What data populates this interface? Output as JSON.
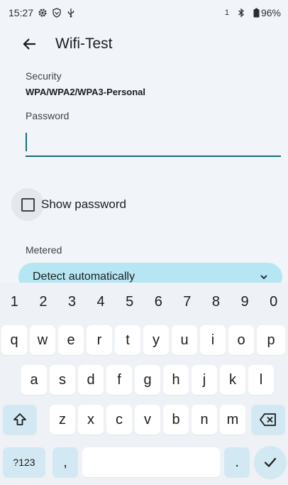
{
  "status_bar": {
    "time": "15:27",
    "sim_slot": "1",
    "battery": "96%"
  },
  "app_bar": {
    "title": "Wifi-Test"
  },
  "form": {
    "security_label": "Security",
    "security_value": "WPA/WPA2/WPA3-Personal",
    "password_label": "Password",
    "password_value": "",
    "show_password_label": "Show password",
    "show_password_checked": false,
    "metered_label": "Metered",
    "metered_value": "Detect automatically"
  },
  "keyboard": {
    "number_row": [
      "1",
      "2",
      "3",
      "4",
      "5",
      "6",
      "7",
      "8",
      "9",
      "0"
    ],
    "row1": [
      "q",
      "w",
      "e",
      "r",
      "t",
      "y",
      "u",
      "i",
      "o",
      "p"
    ],
    "row2": [
      "a",
      "s",
      "d",
      "f",
      "g",
      "h",
      "j",
      "k",
      "l"
    ],
    "row3": [
      "z",
      "x",
      "c",
      "v",
      "b",
      "n",
      "m"
    ],
    "symbols_label": "?123",
    "comma": ",",
    "period": "."
  },
  "colors": {
    "accent": "#1a6d74",
    "dropdown_bg": "#b6e6f4",
    "function_key": "#d2e8f2"
  }
}
